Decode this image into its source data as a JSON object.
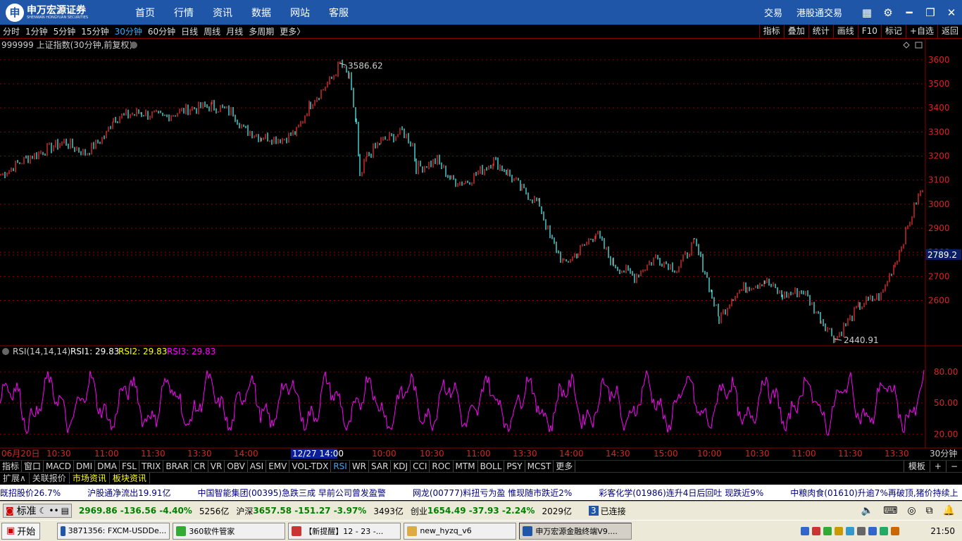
{
  "brand": {
    "name": "申万宏源证券",
    "sub": "SHENWAN HONGYUAN SECURITIES",
    "mark": "申"
  },
  "nav": [
    "首页",
    "行情",
    "资讯",
    "数据",
    "网站",
    "客服"
  ],
  "topright": {
    "trade": "交易",
    "hk": "港股通交易"
  },
  "periods": [
    "分时",
    "1分钟",
    "5分钟",
    "15分钟",
    "30分钟",
    "60分钟",
    "日线",
    "周线",
    "月线",
    "多周期",
    "更多〉"
  ],
  "active_period": "30分钟",
  "toolbar_right": [
    "指标",
    "叠加",
    "统计",
    "画线",
    "F10",
    "标记",
    "+自选",
    "返回"
  ],
  "symbol_title": "999999 上证指数(30分钟,前复权)",
  "rsi_title": "RSI(14,14,14)",
  "rsi_values": {
    "rsi1": "RSI1: 29.83",
    "rsi2": "RSI2: 29.83",
    "rsi3": "RSI3: 29.83"
  },
  "high_label": "3586.62",
  "low_label": "2440.91",
  "current_price": "2789.2",
  "cursor_time": "12/27 14:00",
  "period_label": "30分钟",
  "chart_data": {
    "type": "line",
    "title": "999999 上证指数(30分钟,前复权)",
    "ylim": [
      2420,
      3620
    ],
    "yticks": [
      3600,
      3500,
      3400,
      3300,
      3200,
      3100,
      3000,
      2900,
      2800,
      2700,
      2600
    ],
    "price_path": [
      [
        0,
        3120
      ],
      [
        30,
        3180
      ],
      [
        60,
        3220
      ],
      [
        90,
        3260
      ],
      [
        120,
        3210
      ],
      [
        150,
        3290
      ],
      [
        160,
        3360
      ],
      [
        200,
        3380
      ],
      [
        230,
        3360
      ],
      [
        260,
        3390
      ],
      [
        300,
        3410
      ],
      [
        330,
        3380
      ],
      [
        345,
        3310
      ],
      [
        370,
        3280
      ],
      [
        400,
        3270
      ],
      [
        420,
        3300
      ],
      [
        440,
        3420
      ],
      [
        470,
        3520
      ],
      [
        482,
        3586
      ],
      [
        495,
        3520
      ],
      [
        505,
        3330
      ],
      [
        510,
        3100
      ],
      [
        520,
        3200
      ],
      [
        540,
        3260
      ],
      [
        570,
        3300
      ],
      [
        585,
        3250
      ],
      [
        590,
        3150
      ],
      [
        620,
        3180
      ],
      [
        640,
        3100
      ],
      [
        660,
        3090
      ],
      [
        700,
        3180
      ],
      [
        720,
        3130
      ],
      [
        740,
        3060
      ],
      [
        765,
        3000
      ],
      [
        780,
        2860
      ],
      [
        800,
        2750
      ],
      [
        820,
        2800
      ],
      [
        845,
        2880
      ],
      [
        870,
        2750
      ],
      [
        900,
        2700
      ],
      [
        930,
        2780
      ],
      [
        960,
        2730
      ],
      [
        985,
        2840
      ],
      [
        1000,
        2720
      ],
      [
        1010,
        2620
      ],
      [
        1020,
        2520
      ],
      [
        1040,
        2620
      ],
      [
        1060,
        2660
      ],
      [
        1085,
        2680
      ],
      [
        1110,
        2620
      ],
      [
        1140,
        2640
      ],
      [
        1165,
        2520
      ],
      [
        1185,
        2440
      ],
      [
        1220,
        2580
      ],
      [
        1250,
        2620
      ],
      [
        1270,
        2760
      ],
      [
        1285,
        2880
      ],
      [
        1300,
        3010
      ],
      [
        1312,
        3080
      ]
    ],
    "rsi_ylim": [
      10,
      95
    ],
    "rsi_ticks": [
      80,
      50,
      20
    ],
    "xticks": [
      "06月20日",
      "10:30",
      "11:00",
      "11:30",
      "13:30",
      "14:00",
      "14:30",
      "10:00",
      "10:30",
      "11:00",
      "13:30",
      "14:00",
      "14:30",
      "15:00",
      "10:00",
      "10:30",
      "11:00",
      "11:30",
      "13:30"
    ]
  },
  "indicators": [
    "指标",
    "窗口",
    "MACD",
    "DMI",
    "DMA",
    "FSL",
    "TRIX",
    "BRAR",
    "CR",
    "VR",
    "OBV",
    "ASI",
    "EMV",
    "VOL-TDX",
    "RSI",
    "WR",
    "SAR",
    "KDJ",
    "CCI",
    "ROC",
    "MTM",
    "BOLL",
    "PSY",
    "MCST",
    "更多"
  ],
  "active_indicator": "RSI",
  "indicators_right": [
    "模板",
    "+",
    "−"
  ],
  "tabs": [
    "扩展∧",
    "关联报价",
    "市场资讯",
    "板块资讯"
  ],
  "ticker": [
    "既招股价26.7%",
    "沪股通净流出19.91亿",
    "中国智能集团(00395)急跌三成 早前公司曾发盈警",
    "网龙(00777)料扭亏为盈 惟现随市跌近2%",
    "彩客化学(01986)连升4日后回吐 现跌近9%",
    "中粮肉食(01610)升逾7%再破顶,猪价持续上"
  ],
  "status": {
    "mode": "标准",
    "sh": "2969.86 -136.56 -4.40%",
    "sh_amt": "5256亿",
    "hs_lbl": "沪深",
    "hs": "3657.58 -151.27 -3.97%",
    "hs_amt": "3493亿",
    "cy_lbl": "创业",
    "cy": "1654.49 -37.93 -2.24%",
    "cy_amt": "2029亿",
    "conn_num": "3",
    "conn": "已连接"
  },
  "taskbar": {
    "start": "开始",
    "tasks": [
      "3871356: FXCM-USDDe...",
      "360软件管家",
      "【新提醒】12 - 23 -...",
      "new_hyzq_v6",
      "申万宏源金融终端V9...."
    ],
    "clock": "21:50"
  }
}
